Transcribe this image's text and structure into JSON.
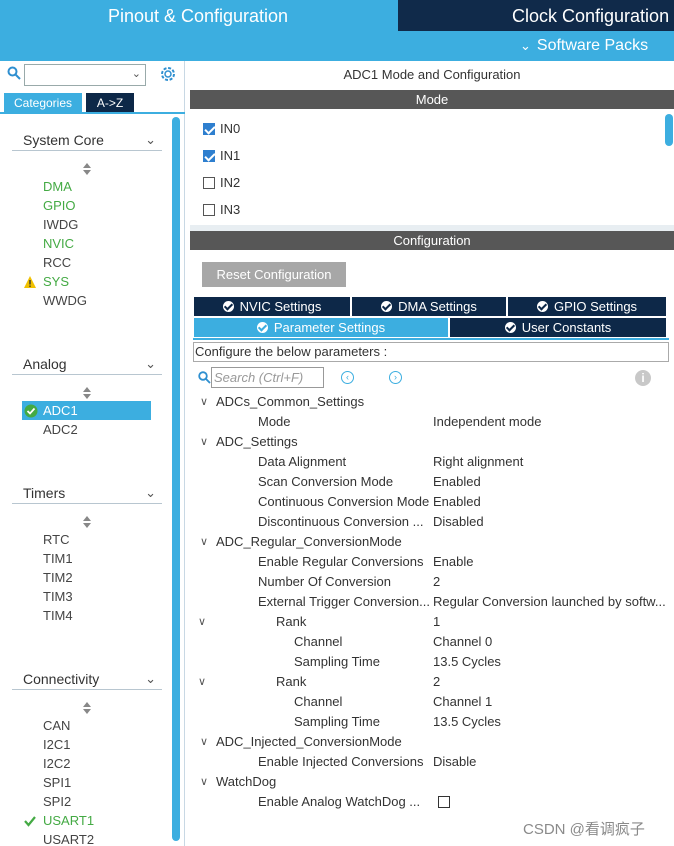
{
  "tabs": {
    "pinout": "Pinout & Configuration",
    "clock": "Clock Configuration",
    "software_packs": "Software Packs"
  },
  "left": {
    "category_tabs": [
      "Categories",
      "A->Z"
    ],
    "groups": [
      {
        "title": "System Core",
        "items": [
          {
            "label": "DMA",
            "state": "green"
          },
          {
            "label": "GPIO",
            "state": "green"
          },
          {
            "label": "IWDG",
            "state": "normal"
          },
          {
            "label": "NVIC",
            "state": "green"
          },
          {
            "label": "RCC",
            "state": "normal"
          },
          {
            "label": "SYS",
            "state": "warning"
          },
          {
            "label": "WWDG",
            "state": "normal"
          }
        ]
      },
      {
        "title": "Analog",
        "items": [
          {
            "label": "ADC1",
            "state": "selected"
          },
          {
            "label": "ADC2",
            "state": "normal"
          }
        ]
      },
      {
        "title": "Timers",
        "items": [
          {
            "label": "RTC",
            "state": "normal"
          },
          {
            "label": "TIM1",
            "state": "normal"
          },
          {
            "label": "TIM2",
            "state": "normal"
          },
          {
            "label": "TIM3",
            "state": "normal"
          },
          {
            "label": "TIM4",
            "state": "normal"
          }
        ]
      },
      {
        "title": "Connectivity",
        "items": [
          {
            "label": "CAN",
            "state": "normal"
          },
          {
            "label": "I2C1",
            "state": "normal"
          },
          {
            "label": "I2C2",
            "state": "normal"
          },
          {
            "label": "SPI1",
            "state": "normal"
          },
          {
            "label": "SPI2",
            "state": "normal"
          },
          {
            "label": "USART1",
            "state": "checked"
          },
          {
            "label": "USART2",
            "state": "normal"
          }
        ]
      }
    ]
  },
  "right": {
    "title": "ADC1 Mode and Configuration",
    "mode_header": "Mode",
    "mode_items": [
      {
        "label": "IN0",
        "checked": true
      },
      {
        "label": "IN1",
        "checked": true
      },
      {
        "label": "IN2",
        "checked": false
      },
      {
        "label": "IN3",
        "checked": false
      }
    ],
    "config_header": "Configuration",
    "reset_button": "Reset Configuration",
    "settings_tabs": {
      "nvic": "NVIC Settings",
      "dma": "DMA Settings",
      "gpio": "GPIO Settings",
      "parameter": "Parameter Settings",
      "user_constants": "User Constants"
    },
    "configure_label": "Configure the below parameters :",
    "search_placeholder": "Search (Ctrl+F)",
    "params": [
      {
        "level": 0,
        "caret": true,
        "name": "ADCs_Common_Settings",
        "value": ""
      },
      {
        "level": 1,
        "name": "Mode",
        "value": "Independent mode"
      },
      {
        "level": 0,
        "caret": true,
        "name": "ADC_Settings",
        "value": ""
      },
      {
        "level": 1,
        "name": "Data Alignment",
        "value": "Right alignment"
      },
      {
        "level": 1,
        "name": "Scan Conversion Mode",
        "value": "Enabled"
      },
      {
        "level": 1,
        "name": "Continuous Conversion Mode",
        "value": "Enabled"
      },
      {
        "level": 1,
        "name": "Discontinuous Conversion ...",
        "value": "Disabled"
      },
      {
        "level": 0,
        "caret": true,
        "name": "ADC_Regular_ConversionMode",
        "value": ""
      },
      {
        "level": 1,
        "name": "Enable Regular Conversions",
        "value": "Enable"
      },
      {
        "level": 1,
        "name": "Number Of Conversion",
        "value": "2"
      },
      {
        "level": 1,
        "name": "External Trigger Conversion...",
        "value": "Regular Conversion launched by softw..."
      },
      {
        "level": 2,
        "caret": true,
        "name": "Rank",
        "value": "1"
      },
      {
        "level": 3,
        "name": "Channel",
        "value": "Channel 0"
      },
      {
        "level": 3,
        "name": "Sampling Time",
        "value": "13.5 Cycles"
      },
      {
        "level": 2,
        "caret": true,
        "name": "Rank",
        "value": "2"
      },
      {
        "level": 3,
        "name": "Channel",
        "value": "Channel 1"
      },
      {
        "level": 3,
        "name": "Sampling Time",
        "value": "13.5 Cycles"
      },
      {
        "level": 0,
        "caret": true,
        "name": "ADC_Injected_ConversionMode",
        "value": ""
      },
      {
        "level": 1,
        "name": "Enable Injected Conversions",
        "value": "Disable"
      },
      {
        "level": 0,
        "caret": true,
        "name": "WatchDog",
        "value": ""
      },
      {
        "level": 1,
        "name": "Enable Analog WatchDog ...",
        "value": "",
        "checkbox": true
      }
    ]
  },
  "watermark": "CSDN @看调疯子",
  "colors": {
    "accent": "#3caee0",
    "dark": "#0d2848",
    "bar": "#575757",
    "green": "#44aa44"
  }
}
